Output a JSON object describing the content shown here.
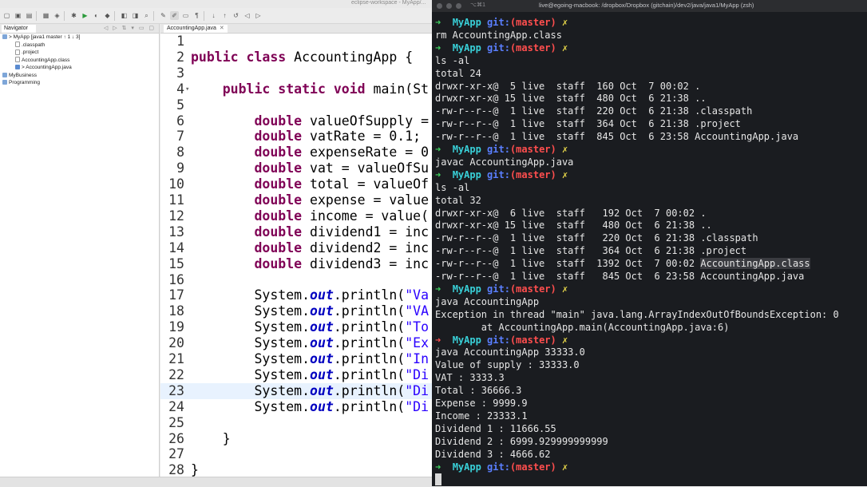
{
  "eclipse": {
    "window_title": "eclipse-workspace - MyApp/...",
    "navigator": {
      "tab_label": "Navigator",
      "items": [
        {
          "label": "> MyApp [java1 master ↑ 1 ↓ 3]",
          "indent": 0,
          "icon": "folder-icon"
        },
        {
          "label": ".classpath",
          "indent": 1,
          "icon": "file-icon"
        },
        {
          "label": ".project",
          "indent": 1,
          "icon": "file-icon"
        },
        {
          "label": "AccountingApp.class",
          "indent": 1,
          "icon": "class-file-icon"
        },
        {
          "label": "> AccountingApp.java",
          "indent": 1,
          "icon": "java-file-icon"
        },
        {
          "label": "MyBusiness",
          "indent": 0,
          "icon": "folder-icon"
        },
        {
          "label": "Programming",
          "indent": 0,
          "icon": "folder-icon"
        }
      ]
    },
    "editor": {
      "tab_label": "AccountingApp.java",
      "highlighted_line": 23,
      "lines": [
        {
          "n": "1",
          "parts": []
        },
        {
          "n": "2",
          "parts": [
            [
              "kw",
              "public"
            ],
            [
              "",
              " "
            ],
            [
              "kw",
              "class"
            ],
            [
              "",
              " AccountingApp {"
            ]
          ]
        },
        {
          "n": "3",
          "parts": []
        },
        {
          "n": "4",
          "marker": true,
          "parts": [
            [
              "",
              "    "
            ],
            [
              "kw",
              "public"
            ],
            [
              "",
              " "
            ],
            [
              "kw",
              "static"
            ],
            [
              "",
              " "
            ],
            [
              "kw",
              "void"
            ],
            [
              "",
              " main(St"
            ]
          ]
        },
        {
          "n": "5",
          "parts": []
        },
        {
          "n": "6",
          "parts": [
            [
              "",
              "        "
            ],
            [
              "kw",
              "double"
            ],
            [
              "",
              " valueOfSupply ="
            ]
          ]
        },
        {
          "n": "7",
          "parts": [
            [
              "",
              "        "
            ],
            [
              "kw",
              "double"
            ],
            [
              "",
              " vatRate = 0.1;"
            ]
          ]
        },
        {
          "n": "8",
          "parts": [
            [
              "",
              "        "
            ],
            [
              "kw",
              "double"
            ],
            [
              "",
              " expenseRate = 0"
            ]
          ]
        },
        {
          "n": "9",
          "parts": [
            [
              "",
              "        "
            ],
            [
              "kw",
              "double"
            ],
            [
              "",
              " vat = valueOfSu"
            ]
          ]
        },
        {
          "n": "10",
          "parts": [
            [
              "",
              "        "
            ],
            [
              "kw",
              "double"
            ],
            [
              "",
              " total = valueOf"
            ]
          ]
        },
        {
          "n": "11",
          "parts": [
            [
              "",
              "        "
            ],
            [
              "kw",
              "double"
            ],
            [
              "",
              " expense = value"
            ]
          ]
        },
        {
          "n": "12",
          "parts": [
            [
              "",
              "        "
            ],
            [
              "kw",
              "double"
            ],
            [
              "",
              " income = value("
            ]
          ]
        },
        {
          "n": "13",
          "parts": [
            [
              "",
              "        "
            ],
            [
              "kw",
              "double"
            ],
            [
              "",
              " dividend1 = inc"
            ]
          ]
        },
        {
          "n": "14",
          "parts": [
            [
              "",
              "        "
            ],
            [
              "kw",
              "double"
            ],
            [
              "",
              " dividend2 = inc"
            ]
          ]
        },
        {
          "n": "15",
          "parts": [
            [
              "",
              "        "
            ],
            [
              "kw",
              "double"
            ],
            [
              "",
              " dividend3 = inc"
            ]
          ]
        },
        {
          "n": "16",
          "parts": []
        },
        {
          "n": "17",
          "parts": [
            [
              "",
              "        System."
            ],
            [
              "fld",
              "out"
            ],
            [
              "",
              ".println("
            ],
            [
              "str",
              "\"Va"
            ]
          ]
        },
        {
          "n": "18",
          "parts": [
            [
              "",
              "        System."
            ],
            [
              "fld",
              "out"
            ],
            [
              "",
              ".println("
            ],
            [
              "str",
              "\"VA"
            ]
          ]
        },
        {
          "n": "19",
          "parts": [
            [
              "",
              "        System."
            ],
            [
              "fld",
              "out"
            ],
            [
              "",
              ".println("
            ],
            [
              "str",
              "\"To"
            ]
          ]
        },
        {
          "n": "20",
          "parts": [
            [
              "",
              "        System."
            ],
            [
              "fld",
              "out"
            ],
            [
              "",
              ".println("
            ],
            [
              "str",
              "\"Ex"
            ]
          ]
        },
        {
          "n": "21",
          "parts": [
            [
              "",
              "        System."
            ],
            [
              "fld",
              "out"
            ],
            [
              "",
              ".println("
            ],
            [
              "str",
              "\"In"
            ]
          ]
        },
        {
          "n": "22",
          "parts": [
            [
              "",
              "        System."
            ],
            [
              "fld",
              "out"
            ],
            [
              "",
              ".println("
            ],
            [
              "str",
              "\"Di"
            ]
          ]
        },
        {
          "n": "23",
          "parts": [
            [
              "",
              "        System."
            ],
            [
              "fld",
              "out"
            ],
            [
              "",
              ".println("
            ],
            [
              "str",
              "\"Di"
            ]
          ]
        },
        {
          "n": "24",
          "parts": [
            [
              "",
              "        System."
            ],
            [
              "fld",
              "out"
            ],
            [
              "",
              ".println("
            ],
            [
              "str",
              "\"Di"
            ]
          ]
        },
        {
          "n": "25",
          "parts": []
        },
        {
          "n": "26",
          "parts": [
            [
              "",
              "    }"
            ]
          ]
        },
        {
          "n": "27",
          "parts": []
        },
        {
          "n": "28",
          "parts": [
            [
              "",
              "}"
            ]
          ]
        }
      ]
    }
  },
  "terminal": {
    "badge": "⌥⌘1",
    "title": "live@egoing-macbook: /dropbox/Dropbox (gitchain)/dev2/java/java1/MyApp (zsh)",
    "prompt": {
      "repo": "MyApp",
      "git_label": "git:",
      "branch": "(master)",
      "dirty": "✗"
    },
    "lines": [
      {
        "type": "prompt",
        "status": "ok"
      },
      {
        "type": "text",
        "text": "rm AccountingApp.class"
      },
      {
        "type": "prompt",
        "status": "ok"
      },
      {
        "type": "text",
        "text": "ls -al"
      },
      {
        "type": "text",
        "text": "total 24"
      },
      {
        "type": "text",
        "text": "drwxr-xr-x@  5 live  staff  160 Oct  7 00:02 ."
      },
      {
        "type": "text",
        "text": "drwxr-xr-x@ 15 live  staff  480 Oct  6 21:38 .."
      },
      {
        "type": "text",
        "text": "-rw-r--r--@  1 live  staff  220 Oct  6 21:38 .classpath"
      },
      {
        "type": "text",
        "text": "-rw-r--r--@  1 live  staff  364 Oct  6 21:38 .project"
      },
      {
        "type": "text",
        "text": "-rw-r--r--@  1 live  staff  845 Oct  6 23:58 AccountingApp.java"
      },
      {
        "type": "prompt",
        "status": "ok"
      },
      {
        "type": "text",
        "text": "javac AccountingApp.java"
      },
      {
        "type": "prompt",
        "status": "ok"
      },
      {
        "type": "text",
        "text": "ls -al"
      },
      {
        "type": "text",
        "text": "total 32"
      },
      {
        "type": "text",
        "text": "drwxr-xr-x@  6 live  staff   192 Oct  7 00:02 ."
      },
      {
        "type": "text",
        "text": "drwxr-xr-x@ 15 live  staff   480 Oct  6 21:38 .."
      },
      {
        "type": "text",
        "text": "-rw-r--r--@  1 live  staff   220 Oct  6 21:38 .classpath"
      },
      {
        "type": "text",
        "text": "-rw-r--r--@  1 live  staff   364 Oct  6 21:38 .project"
      },
      {
        "type": "selected",
        "text": "-rw-r--r--@  1 live  staff  1392 Oct  7 00:02 ",
        "selected_text": "AccountingApp.class"
      },
      {
        "type": "text",
        "text": "-rw-r--r--@  1 live  staff   845 Oct  6 23:58 AccountingApp.java"
      },
      {
        "type": "prompt",
        "status": "ok"
      },
      {
        "type": "text",
        "text": "java AccountingApp"
      },
      {
        "type": "text",
        "text": "Exception in thread \"main\" java.lang.ArrayIndexOutOfBoundsException: 0"
      },
      {
        "type": "text",
        "text": "        at AccountingApp.main(AccountingApp.java:6)"
      },
      {
        "type": "prompt",
        "status": "error"
      },
      {
        "type": "text",
        "text": "java AccountingApp 33333.0"
      },
      {
        "type": "text",
        "text": "Value of supply : 33333.0"
      },
      {
        "type": "text",
        "text": "VAT : 3333.3"
      },
      {
        "type": "text",
        "text": "Total : 36666.3"
      },
      {
        "type": "text",
        "text": "Expense : 9999.9"
      },
      {
        "type": "text",
        "text": "Income : 23333.1"
      },
      {
        "type": "text",
        "text": "Dividend 1 : 11666.55"
      },
      {
        "type": "text",
        "text": "Dividend 2 : 6999.929999999999"
      },
      {
        "type": "text",
        "text": "Dividend 3 : 4666.62"
      },
      {
        "type": "prompt",
        "status": "ok"
      },
      {
        "type": "cursor"
      }
    ]
  }
}
